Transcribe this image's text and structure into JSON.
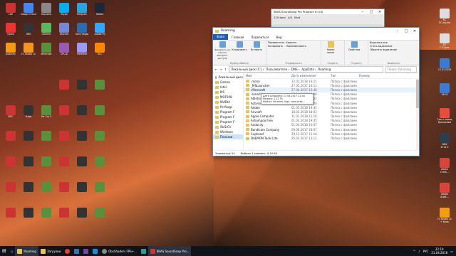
{
  "explorer": {
    "title": "Roaming",
    "tabs": [
      "Файл",
      "Главная",
      "Поделиться",
      "Вид"
    ],
    "ribbon": {
      "clipboard": {
        "pin": "Закрепить на панели быстрого доступа",
        "copy": "Копировать",
        "paste": "Вставить",
        "group": "Буфер обмена"
      },
      "organize": {
        "move": "Переместить",
        "copy_to": "Копировать",
        "delete": "Удалить",
        "rename": "Переименовать",
        "group": "Упорядочить"
      },
      "new": {
        "folder": "Новая папка",
        "group": "Создать"
      },
      "open": {
        "props": "Свойства",
        "group": "Открыть"
      },
      "select": {
        "all": "Выделить все",
        "none": "Снять выделение",
        "invert": "Обратить выделение",
        "group": "Выделить"
      }
    },
    "address": [
      "Локальный диск (C:)",
      "Пользователи",
      "DNS",
      "AppData",
      "Roaming"
    ],
    "search_placeholder": "Поиск: Roaming",
    "nav": [
      "Локальный диск",
      "Games",
      "Intel",
      "MS",
      "MOF008",
      "NVIDIA",
      "PerfLogs",
      "Program F",
      "Program F",
      "Program F",
      "StrSrCV",
      "Windows",
      "Пользов"
    ],
    "columns": [
      "Имя",
      "Дата изменения",
      "Тип",
      "Размер"
    ],
    "files": [
      {
        "name": ".mono",
        "date": "12.01.2018 16:21",
        "type": "Папка с файлами"
      },
      {
        "name": "_MSLauncher",
        "date": "27.05.2017 16:11",
        "type": "Папка с файлами"
      },
      {
        "name": ".Minecraft",
        "date": "27.04.2017 22:40",
        "type": "Папка с файлами"
      },
      {
        "name": ".sonarlint",
        "date": "17.04.2017 10:06",
        "type": "Папка с файлами"
      },
      {
        "name": "Ableton",
        "date": "23.03.2018 12:32",
        "type": "Папка с файлами"
      },
      {
        "name": "Activision",
        "date": "08.02.2018 19:20",
        "type": "Папка с файлами"
      },
      {
        "name": "Adobe",
        "date": "01.03.2018 19:45",
        "type": "Папка с файлами"
      },
      {
        "name": "Anvsoft",
        "date": "18.03.2018 18:03",
        "type": "Папка с файлами"
      },
      {
        "name": "Apple Computer",
        "date": "31.01.2018 21:16",
        "type": "Папка с файлами"
      },
      {
        "name": "Ashampoo Free",
        "date": "01.03.2018 19:45",
        "type": "Папка с файлами"
      },
      {
        "name": "Audacity",
        "date": "01.04.2018 16:07",
        "type": "Папка с файлами"
      },
      {
        "name": "Bandicam Company",
        "date": "09.06.2017 18:07",
        "type": "Папка с файлами"
      },
      {
        "name": "Cuphead",
        "date": "29.12.2017 11:16",
        "type": "Папка с файлами"
      },
      {
        "name": "DAEMON Tools Lite",
        "date": "25.03.2017 13:11",
        "type": "Папка с файлами"
      }
    ],
    "tooltip": [
      "Дата создания: 27.04.2017 22:40",
      "Размер: 1,12 ГБ",
      "Файлы: libraries, logs, resources..."
    ],
    "status": [
      "Элементов: 54",
      "Выбран 1 элемент: 4,19 КБ"
    ]
  },
  "issp": {
    "title": "IBIAS SoundSoap Pro Program 6: Intl",
    "toolbar": [
      "120 bpm",
      "4/4",
      "Mod"
    ]
  },
  "desktop_left": [
    "LAV",
    "Google Chrome",
    "Корзина",
    "Skype",
    "Telegram",
    "Steam",
    "Opera",
    "OBS",
    "uTorrent",
    "Discord",
    "Sony Vegas",
    "Adobe PS",
    "Audacity",
    "FL Studio 12",
    "Minecraft",
    "CPU-Z",
    "Premiere",
    "VLC",
    "EPIC",
    "Fraps",
    "Far Cry 3"
  ],
  "desktop_right": [
    {
      "label": "KC",
      "sub": "ПО.xw.bat"
    },
    {
      "label": "KC",
      "sub": "Г.3.sync"
    },
    {
      "label": "",
      "sub": "12.01.2018"
    },
    {
      "label": "",
      "sub": "18.02"
    },
    {
      "label": "Текст перед",
      "sub": "брелоками"
    },
    {
      "label": "DNX",
      "sub": "4711.5"
    },
    {
      "label": "Adobe",
      "sub": "Creat..."
    },
    {
      "label": "Adobe",
      "sub": "Audit..."
    },
    {
      "label": "FL Studio 12",
      "sub": "+ Кряк"
    }
  ],
  "taskbar": {
    "items": [
      "Roaming",
      "Загрузки",
      "",
      "",
      "",
      "",
      "ObsShaders FPS+...",
      "",
      "IBIAS SoundSoap Pro..."
    ],
    "lang": "РУС",
    "time": "22:19",
    "date": "21.04.2018"
  },
  "colors": {
    "accent": "#1a5fb4",
    "folder": "#e8c25a"
  }
}
